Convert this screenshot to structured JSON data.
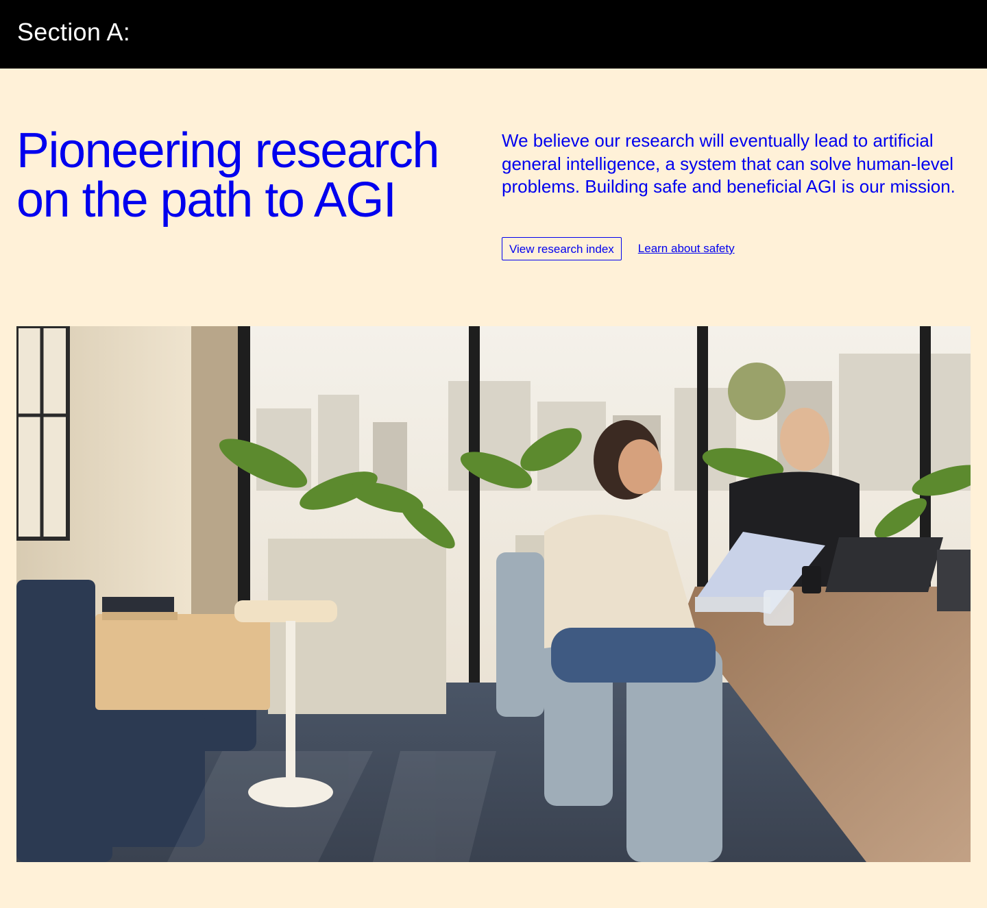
{
  "section_bar": {
    "label": "Section A:"
  },
  "hero": {
    "headline": "Pioneering research on the path to AGI",
    "lead": "We believe our research will eventually lead to artificial general intelligence, a system that can solve human-level problems. Building safe and beneficial AGI is our mission.",
    "primary_button": "View research index",
    "secondary_link": "Learn about safety"
  },
  "colors": {
    "background": "#fff1d8",
    "accent": "#0000ee",
    "bar": "#000000"
  }
}
